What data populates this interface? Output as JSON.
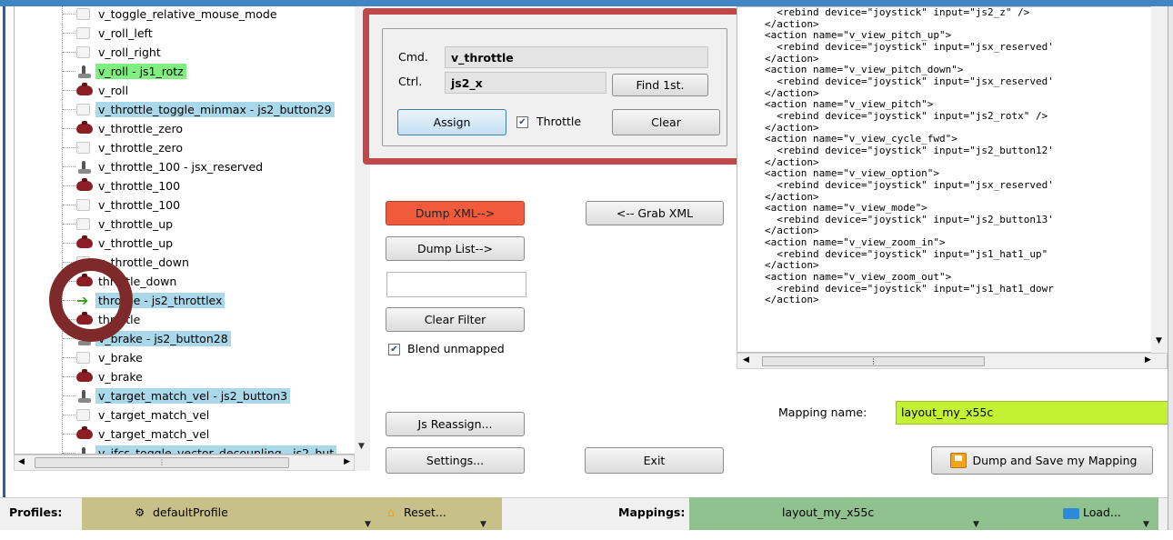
{
  "tree": {
    "items": [
      {
        "label": "v_toggle_relative_mouse_mode",
        "icon": "blank-icon",
        "hl": "none"
      },
      {
        "label": "v_roll_left",
        "icon": "blank-icon",
        "hl": "none"
      },
      {
        "label": "v_roll_right",
        "icon": "blank-icon",
        "hl": "none"
      },
      {
        "label": "v_roll - js1_rotz",
        "icon": "joystick-icon",
        "hl": "green"
      },
      {
        "label": "v_roll",
        "icon": "gamepad-icon",
        "hl": "none"
      },
      {
        "label": "v_throttle_toggle_minmax - js2_button29",
        "icon": "blank-icon",
        "hl": "blue"
      },
      {
        "label": "v_throttle_zero",
        "icon": "gamepad-icon",
        "hl": "none"
      },
      {
        "label": "v_throttle_zero",
        "icon": "blank-icon",
        "hl": "none"
      },
      {
        "label": "v_throttle_100 - jsx_reserved",
        "icon": "joystick-icon",
        "hl": "none"
      },
      {
        "label": "v_throttle_100",
        "icon": "gamepad-icon",
        "hl": "none"
      },
      {
        "label": "v_throttle_100",
        "icon": "blank-icon",
        "hl": "none"
      },
      {
        "label": "v_throttle_up",
        "icon": "blank-icon",
        "hl": "none"
      },
      {
        "label": "v_throttle_up",
        "icon": "gamepad-icon",
        "hl": "none"
      },
      {
        "label": "v_throttle_down",
        "icon": "blank-icon",
        "hl": "none"
      },
      {
        "label": "throttle_down",
        "icon": "gamepad-icon",
        "hl": "none"
      },
      {
        "label": "throttle - js2_throttlex",
        "icon": "arrow-icon",
        "hl": "blue"
      },
      {
        "label": "throttle",
        "icon": "gamepad-icon",
        "hl": "none"
      },
      {
        "label": "v_brake - js2_button28",
        "icon": "joystick-icon",
        "hl": "blue"
      },
      {
        "label": "v_brake",
        "icon": "blank-icon",
        "hl": "none"
      },
      {
        "label": "v_brake",
        "icon": "gamepad-icon",
        "hl": "none"
      },
      {
        "label": "v_target_match_vel - js2_button3",
        "icon": "joystick-icon",
        "hl": "blue"
      },
      {
        "label": "v_target_match_vel",
        "icon": "blank-icon",
        "hl": "none"
      },
      {
        "label": "v_target_match_vel",
        "icon": "gamepad-icon",
        "hl": "none"
      },
      {
        "label": "v_ifcs_toggle_vector_decoupling - js2_but",
        "icon": "joystick-icon",
        "hl": "blue"
      }
    ]
  },
  "assign_panel": {
    "cmd_label": "Cmd.",
    "cmd_value": "v_throttle",
    "ctrl_label": "Ctrl.",
    "ctrl_value": "js2_x",
    "find_button": "Find 1st.",
    "assign_button": "Assign",
    "throttle_label": "Throttle",
    "throttle_checked": true,
    "clear_button": "Clear"
  },
  "actions": {
    "dump_xml": "Dump XML-->",
    "grab_xml": "<-- Grab XML",
    "dump_list": "Dump List-->",
    "filter_value": "",
    "clear_filter": "Clear Filter",
    "blend_label": "Blend unmapped",
    "blend_checked": true,
    "js_reassign": "Js Reassign...",
    "settings": "Settings...",
    "exit": "Exit",
    "dump_save": "Dump and Save my Mapping"
  },
  "xml_text": "  <rebind device=\"joystick\" input=\"js2_z\" />\n</action>\n<action name=\"v_view_pitch_up\">\n  <rebind device=\"joystick\" input=\"jsx_reserved'\n</action>\n<action name=\"v_view_pitch_down\">\n  <rebind device=\"joystick\" input=\"jsx_reserved'\n</action>\n<action name=\"v_view_pitch\">\n  <rebind device=\"joystick\" input=\"js2_rotx\" />\n</action>\n<action name=\"v_view_cycle_fwd\">\n  <rebind device=\"joystick\" input=\"js2_button12'\n</action>\n<action name=\"v_view_option\">\n  <rebind device=\"joystick\" input=\"jsx_reserved'\n</action>\n<action name=\"v_view_mode\">\n  <rebind device=\"joystick\" input=\"js2_button13'\n</action>\n<action name=\"v_view_zoom_in\">\n  <rebind device=\"joystick\" input=\"js1_hat1_up\"\n</action>\n<action name=\"v_view_zoom_out\">\n  <rebind device=\"joystick\" input=\"js1_hat1_dowr\n</action>",
  "mapping": {
    "label": "Mapping name:",
    "value": "layout_my_x55c"
  },
  "statusbar": {
    "profiles_label": "Profiles:",
    "profile_value": "defaultProfile",
    "reset_label": "Reset...",
    "mappings_label": "Mappings:",
    "mapping_value": "layout_my_x55c",
    "load_label": "Load..."
  },
  "colors": {
    "highlight_green": "#7ff07f",
    "highlight_blue": "#a9d8ea",
    "marker_red": "#c04848",
    "dump_xml_button": "#f25a3c",
    "mapping_input": "#c3f234",
    "profiles_segment": "#c8c089",
    "mappings_segment": "#8fc28e"
  }
}
